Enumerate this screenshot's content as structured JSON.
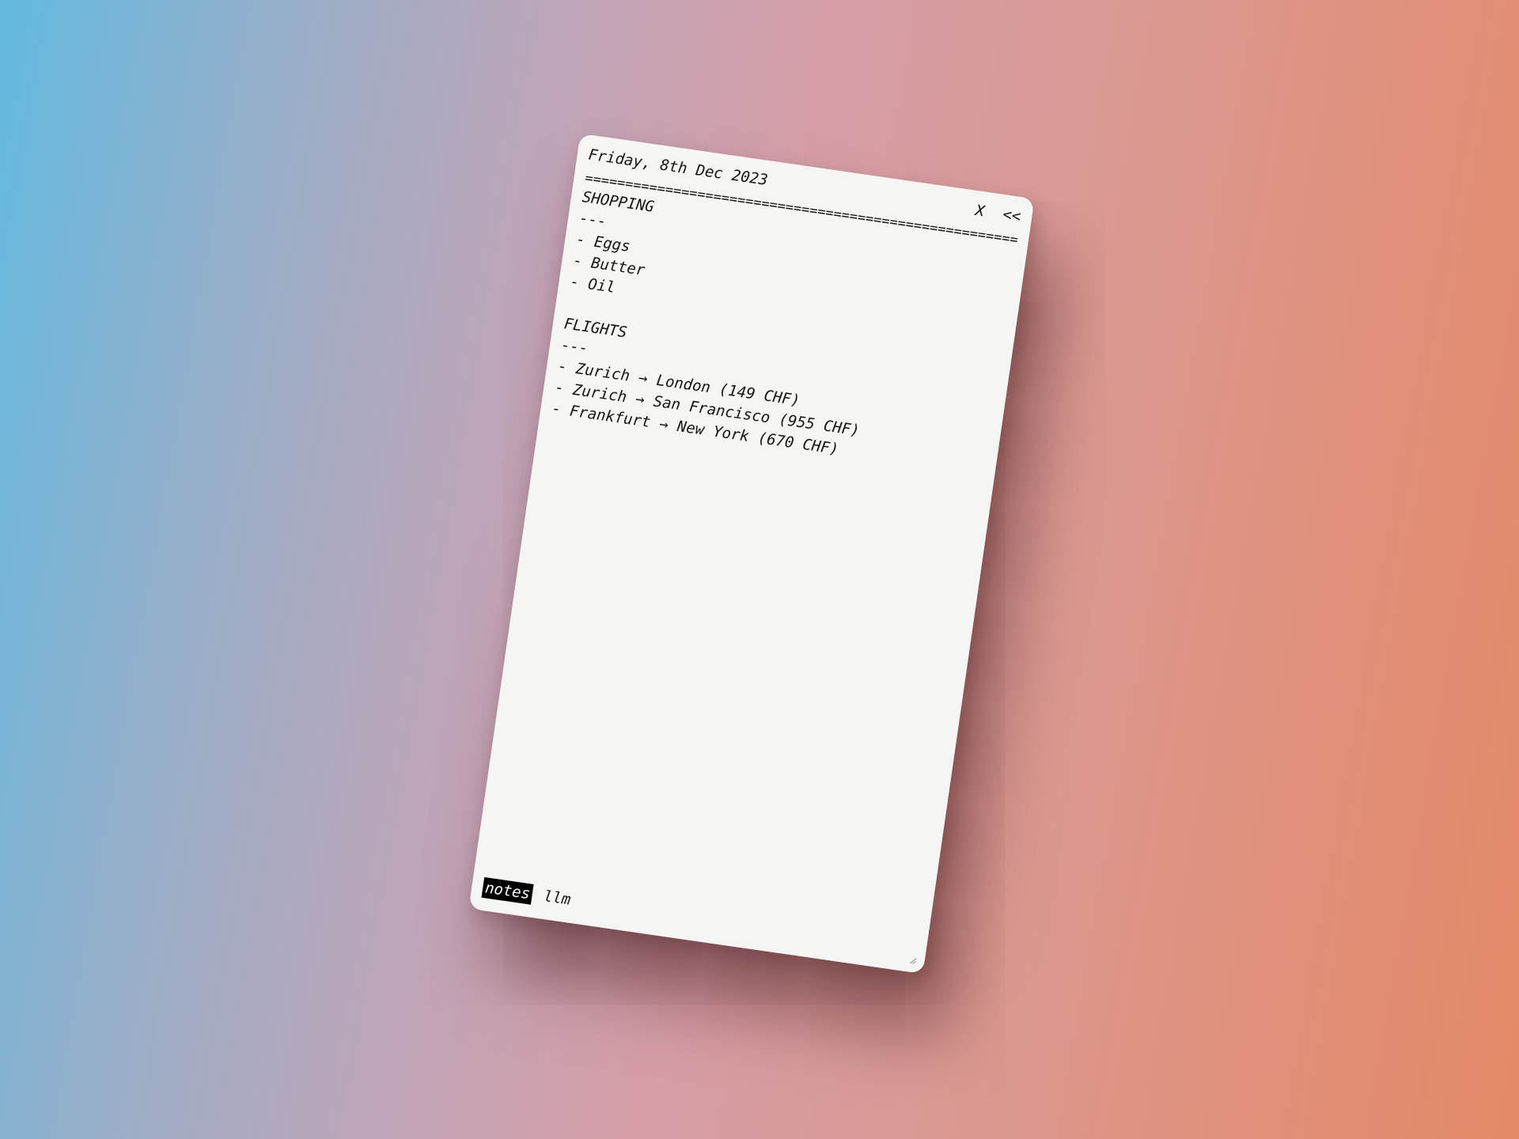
{
  "header": {
    "date": "Friday, 8th Dec 2023",
    "close_label": "X",
    "collapse_label": "<<",
    "divider": "===================================================================="
  },
  "note": {
    "lines": [
      "SHOPPING",
      "---",
      "- Eggs",
      "- Butter",
      "- Oil",
      "",
      "FLIGHTS",
      "---",
      "- Zurich → London (149 CHF)",
      "- Zurich → San Francisco (955 CHF)",
      "- Frankfurt → New York (670 CHF)"
    ]
  },
  "tabs": [
    {
      "label": "notes",
      "active": true
    },
    {
      "label": "llm",
      "active": false
    }
  ],
  "icons": {
    "resize": "resize-grip-icon"
  },
  "colors": {
    "window_background": "#f5f5f3",
    "text": "#161616",
    "active_tab_background": "#000000",
    "active_tab_text": "#ffffff",
    "background_gradient_start": "#63b9e0",
    "background_gradient_middle": "#d59ea7",
    "background_gradient_end": "#e48a68"
  }
}
